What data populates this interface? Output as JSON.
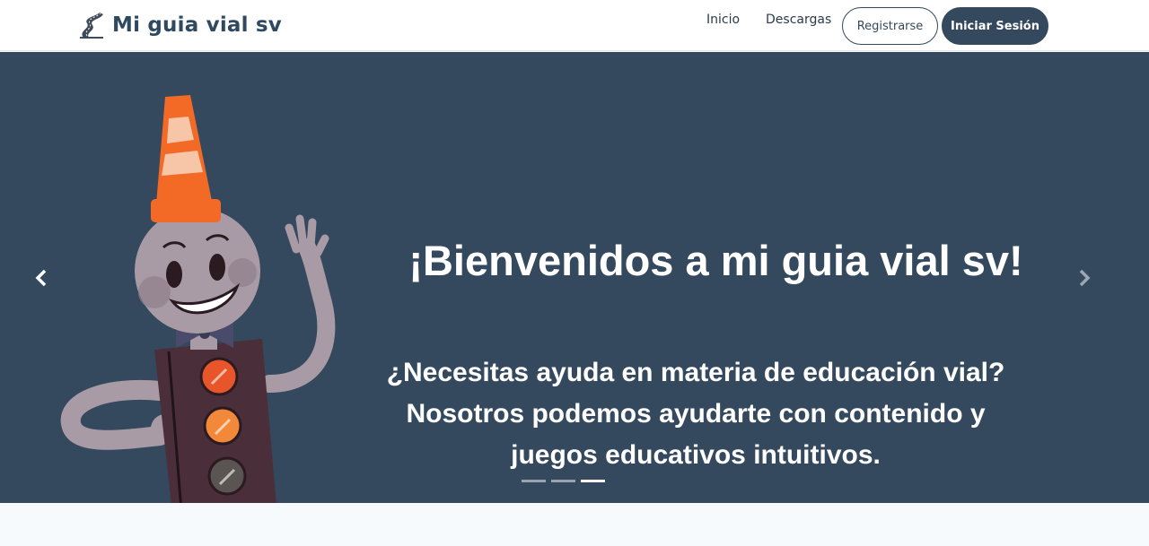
{
  "navbar": {
    "brand_title": "Mi guia vial sv",
    "brand_icon": "winding-road-icon",
    "links": [
      {
        "label": "Inicio"
      },
      {
        "label": "Descargas"
      }
    ],
    "register_label": "Registrarse",
    "login_label": "Iniciar Sesión"
  },
  "hero": {
    "title": "¡Bienvenidos a mi guia vial sv!",
    "subtitle_lines": [
      "¿Necesitas ayuda en materia de educación vial?",
      "Nosotros podemos ayudarte con contenido  y",
      "juegos educativos intuitivos."
    ],
    "prev_icon": "chevron-left-icon",
    "next_icon": "chevron-right-icon",
    "slides_total": 3,
    "active_slide": 3
  },
  "colors": {
    "primary": "#34495e",
    "brand_text": "#2f4a60",
    "cone_orange": "#f26a25",
    "mascot_body": "#4a2f3a",
    "mascot_skin": "#a99ba6"
  }
}
